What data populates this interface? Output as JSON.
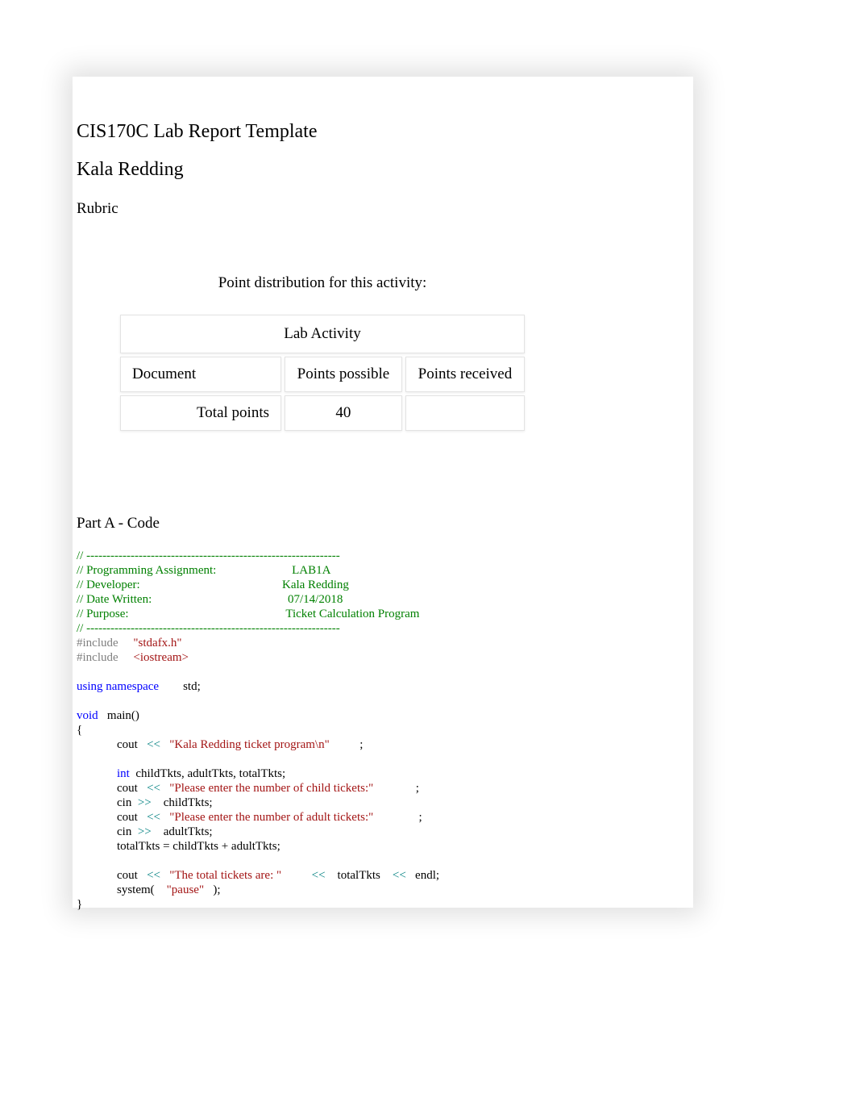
{
  "title": "CIS170C Lab Report Template",
  "author": "Kala Redding",
  "rubric_label": "Rubric",
  "point_distribution": "Point distribution for this activity:",
  "table": {
    "header": "Lab Activity",
    "col1": "Document",
    "col2": "Points possible",
    "col3": "Points received",
    "total_label": "Total points",
    "total_value": "40",
    "total_received": ""
  },
  "section_a": "Part A - Code",
  "code": {
    "c1": "// ---------------------------------------------------------------",
    "c2a": "// Programming Assignment:",
    "c2b": "LAB1A",
    "c3a": "// Developer:",
    "c3b": "Kala Redding",
    "c4a": "// Date Written:",
    "c4b": "07/14/2018",
    "c5a": "// Purpose:",
    "c5b": "Ticket Calculation Program",
    "c6": "// ---------------------------------------------------------------",
    "inc1": "#include",
    "inc1v": "\"stdafx.h\"",
    "inc2": "#include",
    "inc2v": "<iostream>",
    "using": "using",
    "namespace": "namespace",
    "std": "std;",
    "void": "void",
    "main": "main()",
    "lbrace": "{",
    "l1a": "cout",
    "l1b": "<<",
    "l1c": "\"Kala Redding ticket program\\n\"",
    "l1d": ";",
    "l2a": "int",
    "l2b": "childTkts, adultTkts, totalTkts;",
    "l3a": "cout",
    "l3b": "<<",
    "l3c": "\"Please enter the number of child tickets:\"",
    "l3d": ";",
    "l4a": "cin",
    "l4b": ">>",
    "l4c": "childTkts;",
    "l5a": "cout",
    "l5b": "<<",
    "l5c": "\"Please enter the number of adult tickets:\"",
    "l5d": ";",
    "l6a": "cin",
    "l6b": ">>",
    "l6c": "adultTkts;",
    "l7": "totalTkts = childTkts + adultTkts;",
    "l8a": "cout",
    "l8b": "<<",
    "l8c": "\"The total tickets are: \"",
    "l8d": "<<",
    "l8e": "totalTkts",
    "l8f": "<<",
    "l8g": "endl;",
    "l9a": "system(",
    "l9b": "\"pause\"",
    "l9c": ");",
    "rbrace": "}"
  }
}
